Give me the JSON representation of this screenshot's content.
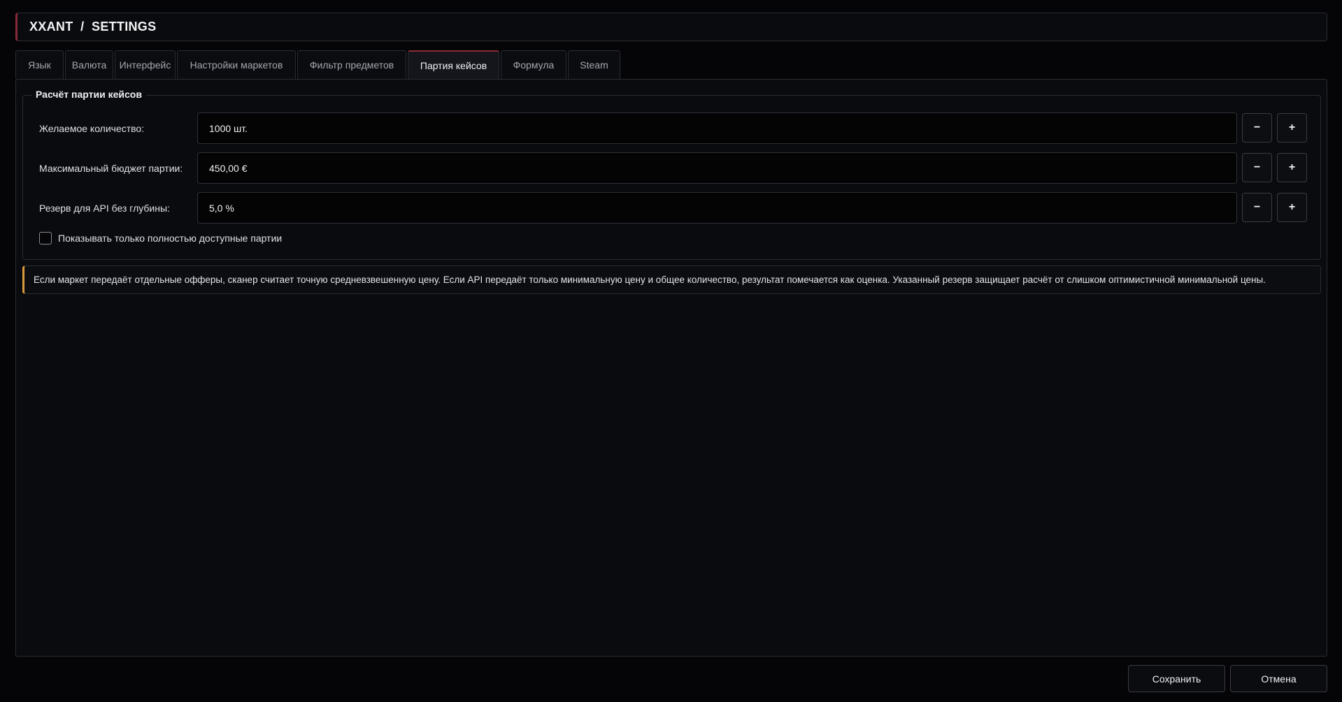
{
  "header": {
    "title": "XXANT  /  SETTINGS"
  },
  "tabs": [
    {
      "label": "Язык",
      "active": false
    },
    {
      "label": "Валюта",
      "active": false
    },
    {
      "label": "Интерфейс",
      "active": false
    },
    {
      "label": "Настройки маркетов",
      "active": false
    },
    {
      "label": "Фильтр предметов",
      "active": false
    },
    {
      "label": "Партия кейсов",
      "active": true
    },
    {
      "label": "Формула",
      "active": false
    },
    {
      "label": "Steam",
      "active": false
    }
  ],
  "group": {
    "title": "Расчёт партии кейсов",
    "fields": [
      {
        "label": "Желаемое количество:",
        "value": "1000 шт."
      },
      {
        "label": "Максимальный бюджет партии:",
        "value": "450,00 €"
      },
      {
        "label": "Резерв для API без глубины:",
        "value": "5,0 %"
      }
    ],
    "stepper": {
      "minus": "−",
      "plus": "+"
    },
    "checkbox": {
      "label": "Показывать только полностью доступные партии",
      "checked": false
    }
  },
  "note": "Если маркет передаёт отдельные офферы, сканер считает точную средневзвешенную цену. Если API передаёт только минимальную цену и общее количество, результат помечается как оценка. Указанный резерв защищает расчёт от слишком оптимистичной минимальной цены.",
  "footer": {
    "save": "Сохранить",
    "cancel": "Отмена"
  },
  "colors": {
    "accent": "#8a2a38",
    "note_accent": "#d99a3a",
    "background": "#050507",
    "panel": "#0a0b0e"
  }
}
